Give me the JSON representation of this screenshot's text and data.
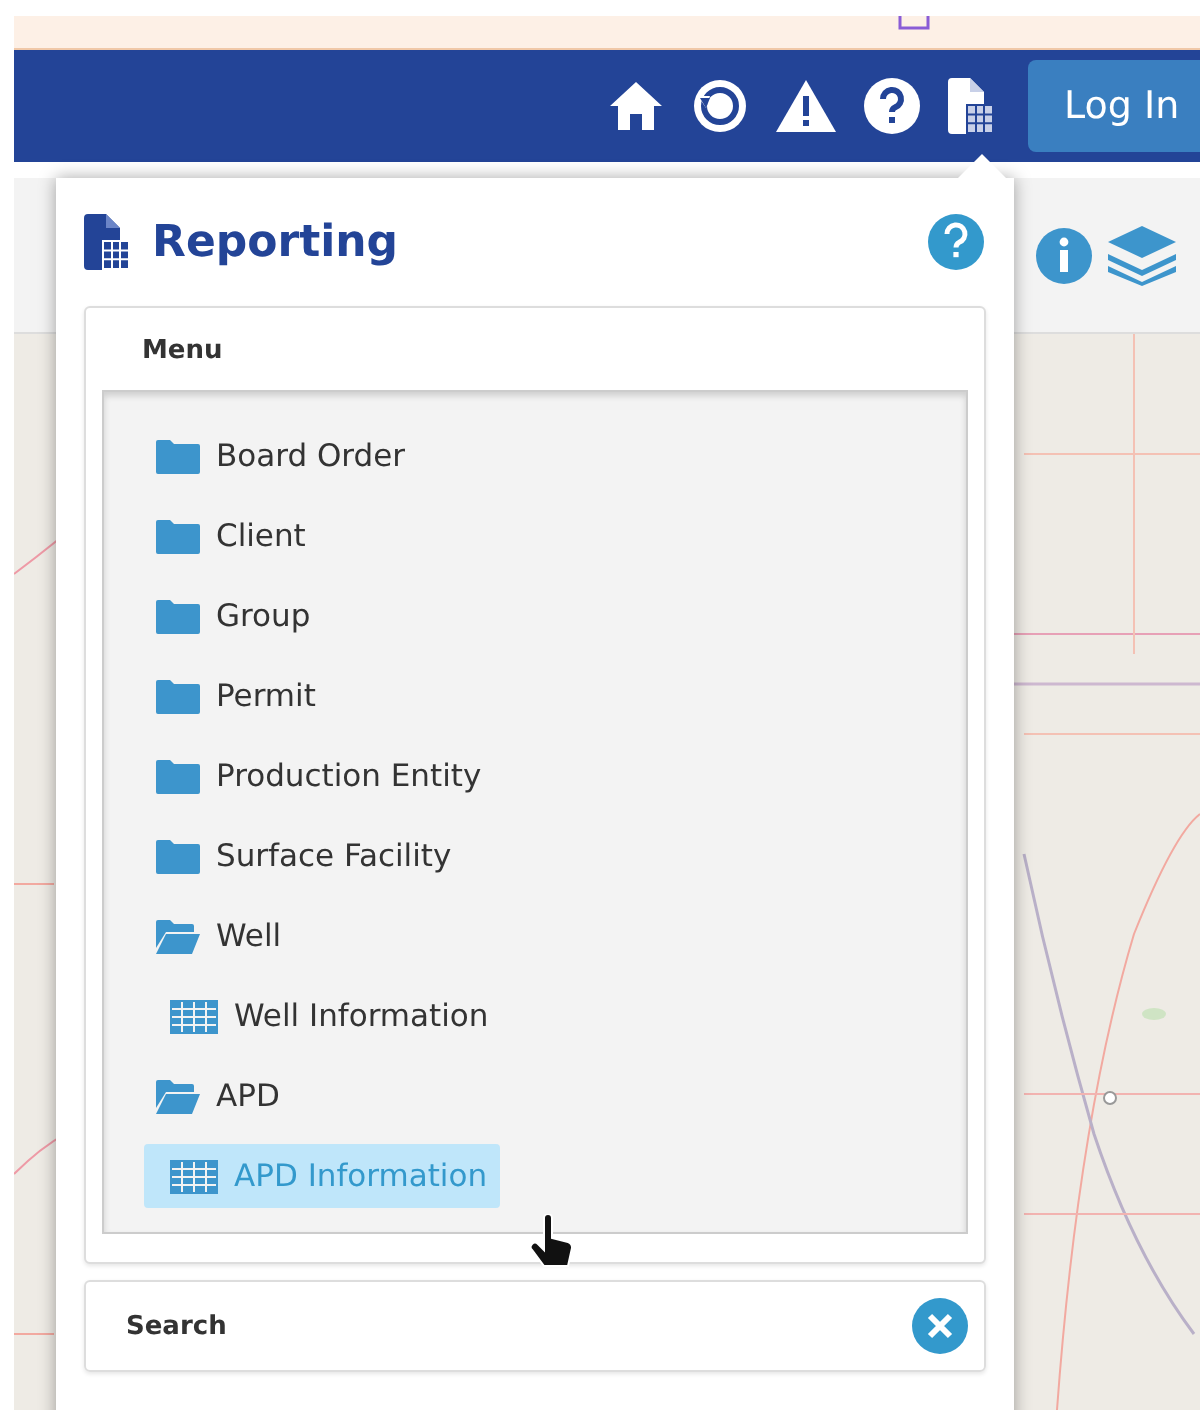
{
  "header": {
    "login_button": "Log In"
  },
  "panel": {
    "title": "Reporting",
    "menu": {
      "title": "Menu",
      "items": [
        {
          "kind": "folder",
          "label": "Board Order",
          "expanded": false,
          "selected": false
        },
        {
          "kind": "folder",
          "label": "Client",
          "expanded": false,
          "selected": false
        },
        {
          "kind": "folder",
          "label": "Group",
          "expanded": false,
          "selected": false
        },
        {
          "kind": "folder",
          "label": "Permit",
          "expanded": false,
          "selected": false
        },
        {
          "kind": "folder",
          "label": "Production Entity",
          "expanded": false,
          "selected": false
        },
        {
          "kind": "folder",
          "label": "Surface Facility",
          "expanded": false,
          "selected": false
        },
        {
          "kind": "folder",
          "label": "Well",
          "expanded": true,
          "selected": false,
          "children": [
            {
              "kind": "report",
              "label": "Well Information",
              "selected": false
            }
          ]
        },
        {
          "kind": "folder",
          "label": "APD",
          "expanded": true,
          "selected": false,
          "children": [
            {
              "kind": "report",
              "label": "APD Information",
              "selected": true
            }
          ]
        }
      ]
    },
    "search": {
      "title": "Search"
    }
  }
}
